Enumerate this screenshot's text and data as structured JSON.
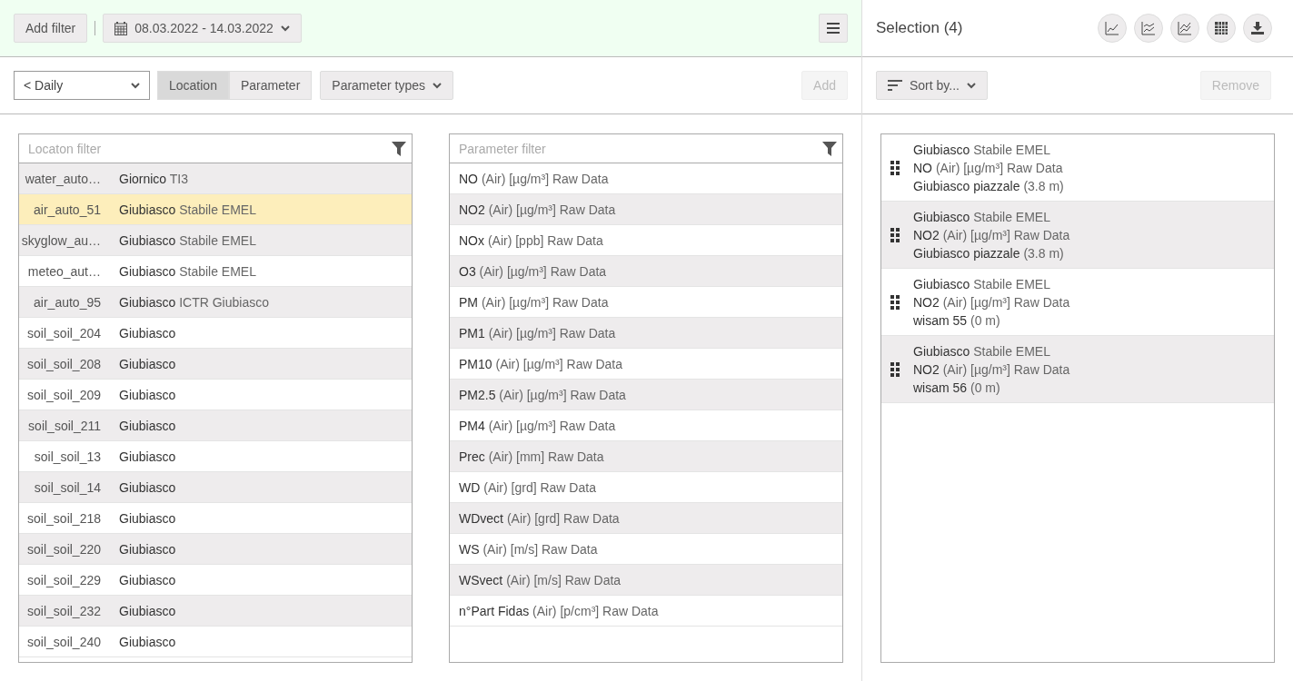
{
  "toolbar": {
    "add_filter": "Add filter",
    "date_range": "08.03.2022 - 14.03.2022"
  },
  "controls": {
    "interval": "< Daily",
    "view_toggle": [
      {
        "label": "Location",
        "selected": true
      },
      {
        "label": "Parameter",
        "selected": false
      }
    ],
    "parameter_types": "Parameter types",
    "add_button": {
      "label": "Add",
      "disabled": true
    }
  },
  "location_list": {
    "placeholder": "Locaton filter",
    "rows": [
      {
        "code": "water_auto…",
        "name": "Giornico",
        "detail": "TI3",
        "selected": false
      },
      {
        "code": "air_auto_51",
        "name": "Giubiasco",
        "detail": "Stabile EMEL",
        "selected": true
      },
      {
        "code": "skyglow_au…",
        "name": "Giubiasco",
        "detail": "Stabile EMEL",
        "selected": false
      },
      {
        "code": "meteo_aut…",
        "name": "Giubiasco",
        "detail": "Stabile EMEL",
        "selected": false
      },
      {
        "code": "air_auto_95",
        "name": "Giubiasco",
        "detail": "ICTR Giubiasco",
        "selected": false
      },
      {
        "code": "soil_soil_204",
        "name": "Giubiasco",
        "selected": false
      },
      {
        "code": "soil_soil_208",
        "name": "Giubiasco",
        "selected": false
      },
      {
        "code": "soil_soil_209",
        "name": "Giubiasco",
        "selected": false
      },
      {
        "code": "soil_soil_211",
        "name": "Giubiasco",
        "selected": false
      },
      {
        "code": "soil_soil_13",
        "name": "Giubiasco",
        "selected": false
      },
      {
        "code": "soil_soil_14",
        "name": "Giubiasco",
        "selected": false
      },
      {
        "code": "soil_soil_218",
        "name": "Giubiasco",
        "selected": false
      },
      {
        "code": "soil_soil_220",
        "name": "Giubiasco",
        "selected": false
      },
      {
        "code": "soil_soil_229",
        "name": "Giubiasco",
        "selected": false
      },
      {
        "code": "soil_soil_232",
        "name": "Giubiasco",
        "selected": false
      },
      {
        "code": "soil_soil_240",
        "name": "Giubiasco",
        "selected": false
      }
    ]
  },
  "parameter_list": {
    "placeholder": "Parameter filter",
    "rows": [
      {
        "name": "NO",
        "detail": "(Air) [µg/m³] Raw Data"
      },
      {
        "name": "NO2",
        "detail": "(Air) [µg/m³] Raw Data"
      },
      {
        "name": "NOx",
        "detail": "(Air) [ppb] Raw Data"
      },
      {
        "name": "O3",
        "detail": "(Air) [µg/m³] Raw Data"
      },
      {
        "name": "PM",
        "detail": "(Air) [µg/m³] Raw Data"
      },
      {
        "name": "PM1",
        "detail": "(Air) [µg/m³] Raw Data"
      },
      {
        "name": "PM10",
        "detail": "(Air) [µg/m³] Raw Data"
      },
      {
        "name": "PM2.5",
        "detail": "(Air) [µg/m³] Raw Data"
      },
      {
        "name": "PM4",
        "detail": "(Air) [µg/m³] Raw Data"
      },
      {
        "name": "Prec",
        "detail": "(Air) [mm] Raw Data"
      },
      {
        "name": "WD",
        "detail": "(Air) [grd] Raw Data"
      },
      {
        "name": "WDvect",
        "detail": "(Air) [grd] Raw Data"
      },
      {
        "name": "WS",
        "detail": "(Air) [m/s] Raw Data"
      },
      {
        "name": "WSvect",
        "detail": "(Air) [m/s] Raw Data"
      },
      {
        "name": "n°Part Fidas",
        "detail": "(Air) [p/cm³] Raw Data"
      }
    ]
  },
  "selection": {
    "title": "Selection (4)",
    "sort": "Sort by...",
    "remove_button": {
      "label": "Remove",
      "disabled": true
    },
    "items": [
      {
        "location": "Giubiasco",
        "location_detail": "Stabile EMEL",
        "parameter": "NO",
        "parameter_detail": "(Air) [µg/m³] Raw Data",
        "station": "Giubiasco piazzale",
        "station_detail": "(3.8 m)"
      },
      {
        "location": "Giubiasco",
        "location_detail": "Stabile EMEL",
        "parameter": "NO2",
        "parameter_detail": "(Air) [µg/m³] Raw Data",
        "station": "Giubiasco piazzale",
        "station_detail": "(3.8 m)"
      },
      {
        "location": "Giubiasco",
        "location_detail": "Stabile EMEL",
        "parameter": "NO2",
        "parameter_detail": "(Air) [µg/m³] Raw Data",
        "station": "wisam 55",
        "station_detail": "(0 m)"
      },
      {
        "location": "Giubiasco",
        "location_detail": "Stabile EMEL",
        "parameter": "NO2",
        "parameter_detail": "(Air) [µg/m³] Raw Data",
        "station": "wisam 56",
        "station_detail": "(0 m)"
      }
    ]
  }
}
